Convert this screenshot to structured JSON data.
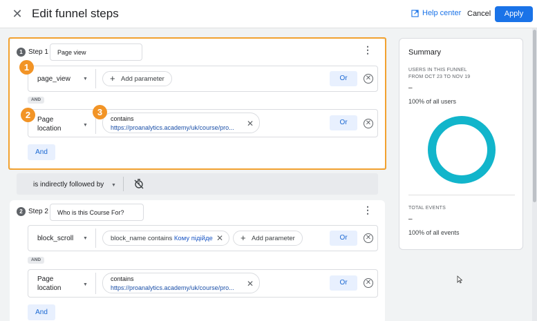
{
  "header": {
    "title": "Edit funnel steps",
    "help_label": "Help center",
    "cancel_label": "Cancel",
    "apply_label": "Apply"
  },
  "step1": {
    "number": "1",
    "label": "Step 1",
    "name": "Page view",
    "row1": {
      "event": "page_view",
      "add_param_label": "Add parameter",
      "or_label": "Or"
    },
    "and_pill": "AND",
    "row2": {
      "event_line1": "Page",
      "event_line2": "location",
      "condition_title": "contains",
      "condition_value": "https://proanalytics.academy/uk/course/pro...",
      "or_label": "Or"
    },
    "and_button": "And"
  },
  "annotations": [
    "1",
    "2",
    "3"
  ],
  "connector": {
    "label": "is indirectly followed by"
  },
  "step2": {
    "number": "2",
    "label": "Step 2",
    "name": "Who is this Course For?",
    "row1": {
      "event": "block_scroll",
      "chip_prefix": "block_name contains",
      "chip_link": "Кому підійде",
      "add_param_label": "Add parameter",
      "or_label": "Or"
    },
    "and_pill": "AND",
    "row2": {
      "event_line1": "Page",
      "event_line2": "location",
      "condition_title": "contains",
      "condition_value": "https://proanalytics.academy/uk/course/pro...",
      "or_label": "Or"
    },
    "and_button": "And"
  },
  "summary": {
    "title": "Summary",
    "users_caption_line1": "USERS IN THIS FUNNEL",
    "users_caption_line2": "FROM OCT 23 TO NOV 19",
    "users_value": "–",
    "users_pct": "100% of all users",
    "events_caption": "TOTAL EVENTS",
    "events_value": "–",
    "events_pct": "100% of all events",
    "donut_color": "#12b5cb"
  }
}
